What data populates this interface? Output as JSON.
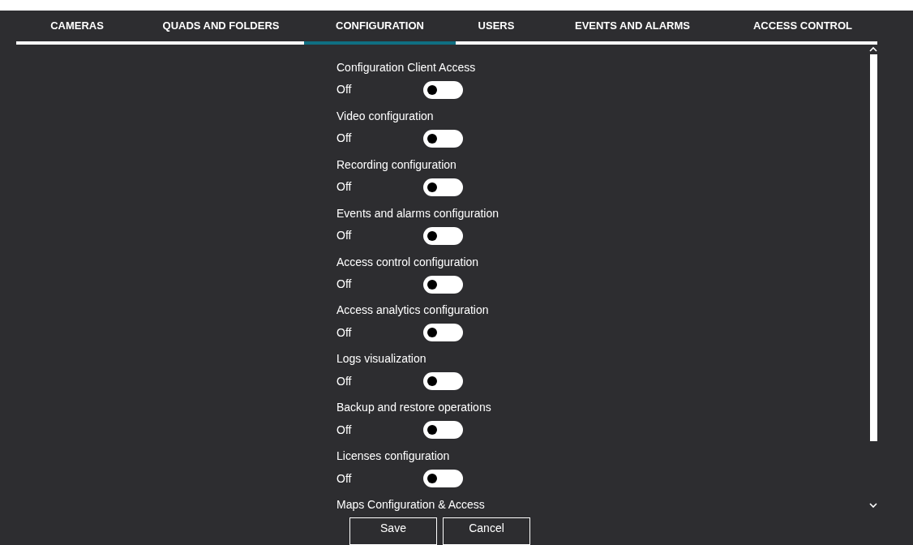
{
  "tabs": [
    {
      "label": "CAMERAS",
      "selected": false
    },
    {
      "label": "QUADS AND FOLDERS",
      "selected": false
    },
    {
      "label": "CONFIGURATION",
      "selected": true
    },
    {
      "label": "USERS",
      "selected": false
    },
    {
      "label": "EVENTS AND ALARMS",
      "selected": false
    },
    {
      "label": "ACCESS CONTROL",
      "selected": false
    }
  ],
  "permissions": [
    {
      "label": "Configuration Client Access",
      "state_text": "Off",
      "on": false
    },
    {
      "label": "Video configuration",
      "state_text": "Off",
      "on": false
    },
    {
      "label": "Recording configuration",
      "state_text": "Off",
      "on": false
    },
    {
      "label": "Events and alarms configuration",
      "state_text": "Off",
      "on": false
    },
    {
      "label": "Access control configuration",
      "state_text": "Off",
      "on": false
    },
    {
      "label": "Access analytics configuration",
      "state_text": "Off",
      "on": false
    },
    {
      "label": "Logs visualization",
      "state_text": "Off",
      "on": false
    },
    {
      "label": "Backup and restore operations",
      "state_text": "Off",
      "on": false
    },
    {
      "label": "Licenses configuration",
      "state_text": "Off",
      "on": false
    },
    {
      "label": "Maps Configuration & Access"
    }
  ],
  "buttons": [
    "Save",
    "Cancel"
  ]
}
